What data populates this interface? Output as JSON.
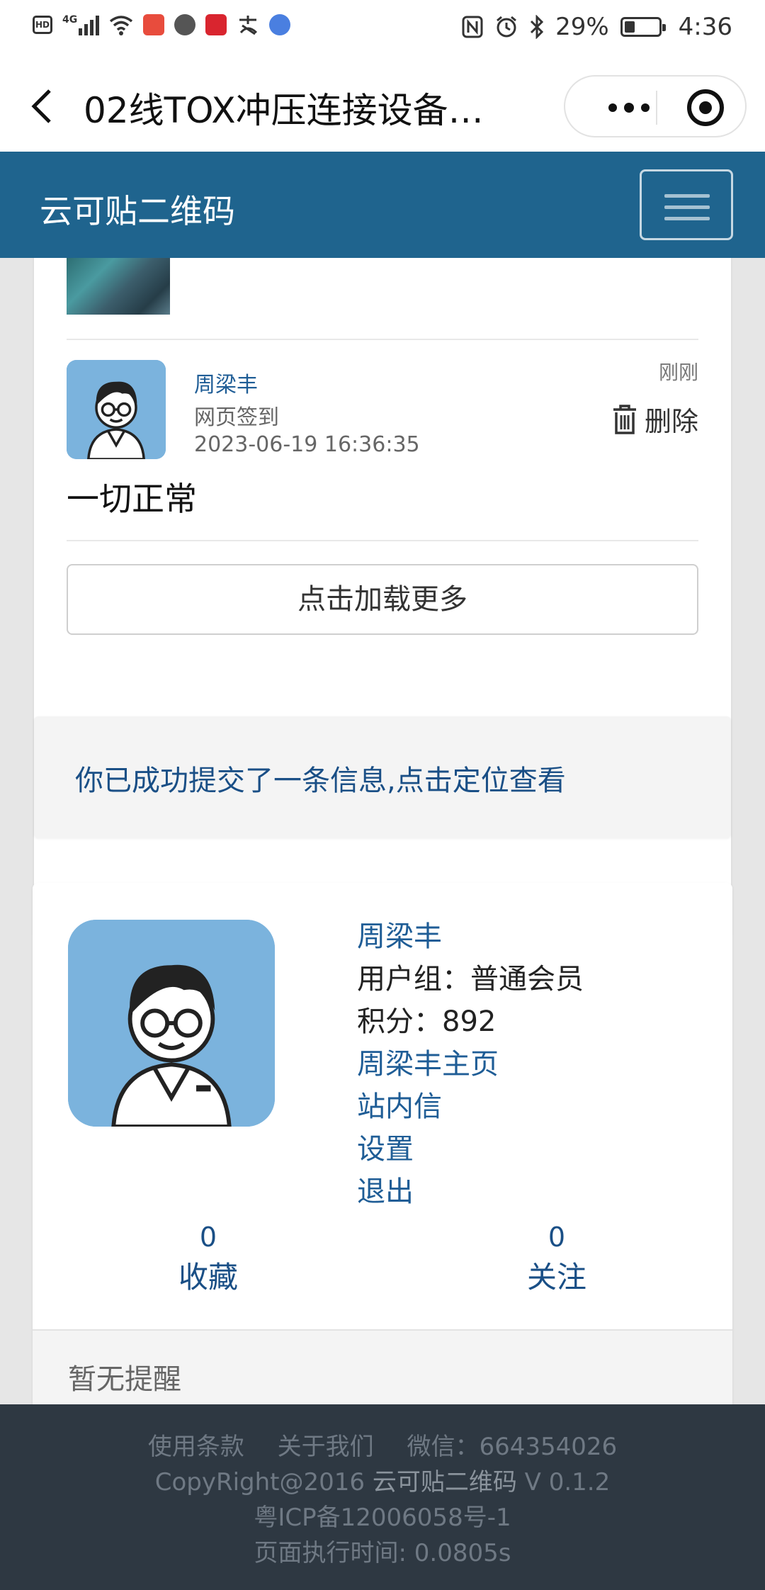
{
  "status_bar": {
    "left_icons": [
      "hd-icon",
      "signal-4g-icon",
      "wifi-icon",
      "app-notification-icon",
      "voice-app-icon",
      "shopping-618-icon",
      "alipay-icon",
      "music-app-icon"
    ],
    "hd_label": "HD",
    "network_label": "4G",
    "battery": "29%",
    "time": "4:36"
  },
  "titlebar": {
    "title": "02线TOX冲压连接设备…"
  },
  "navbar": {
    "brand": "云可贴二维码"
  },
  "comment": {
    "name": "周梁丰",
    "type": "网页签到",
    "datetime": "2023-06-19 16:36:35",
    "ago": "刚刚",
    "delete_label": "删除",
    "body": "一切正常"
  },
  "load_more_label": "点击加载更多",
  "notice_text": "你已成功提交了一条信息,点击定位查看",
  "user": {
    "name": "周梁丰",
    "group": "用户组：普通会员",
    "points": "积分：892",
    "homepage": "周梁丰主页",
    "messages": "站内信",
    "settings": "设置",
    "logout": "退出",
    "stats": [
      {
        "count": "0",
        "label": "收藏"
      },
      {
        "count": "0",
        "label": "关注"
      }
    ],
    "reminder": "暂无提醒"
  },
  "footer": {
    "links": [
      "使用条款",
      "关于我们",
      "微信：664354026"
    ],
    "copyright_prefix": "CopyRight@2016 ",
    "copyright_brand": "云可贴二维码",
    "copyright_version": " V 0.1.2",
    "icp": "粤ICP备12006058号-1",
    "exec_time": "页面执行时间: 0.0805s"
  },
  "colors": {
    "navbar": "#1f648e",
    "link": "#1f5d96",
    "footer_bg": "#2e3842",
    "page_bg": "#e6e6e6",
    "avatar_bg": "#7bb3dd"
  }
}
